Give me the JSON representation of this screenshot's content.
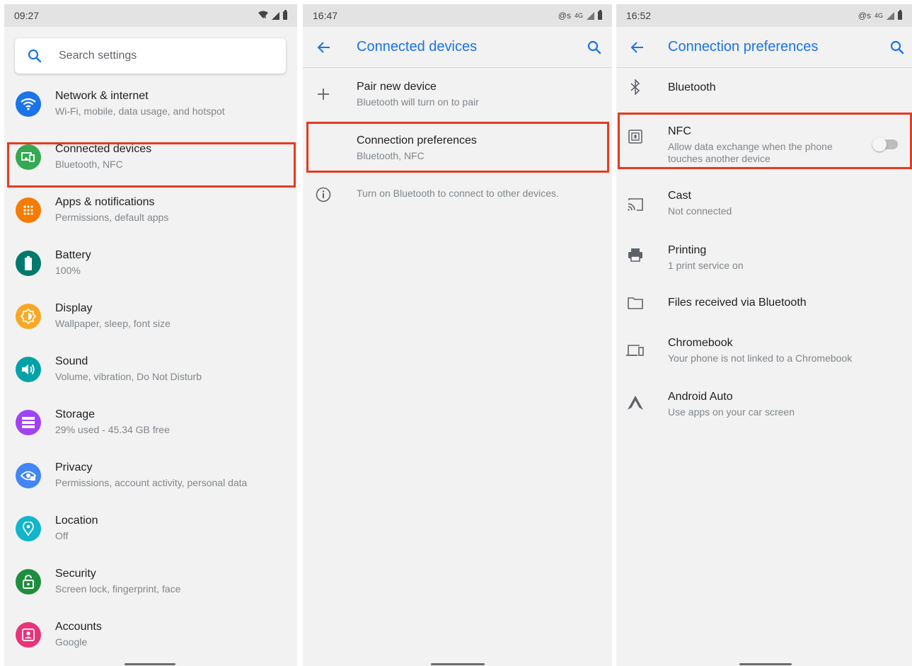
{
  "colors": {
    "accent": "#1a73e8",
    "highlight": "#e53b1f",
    "network": "#1a73e8",
    "connected": "#34a853",
    "apps": "#f57c00",
    "battery": "#00796b",
    "display": "#f9a825",
    "sound": "#00a2a8",
    "storage": "#a142f4",
    "privacy": "#4285f4",
    "location": "#12b5cb",
    "security": "#1e8e3e",
    "accounts": "#e8337a"
  },
  "screen1": {
    "status": {
      "time": "09:27",
      "icons": [
        "wifi-icon",
        "signal-icon",
        "battery-icon"
      ]
    },
    "search": {
      "placeholder": "Search settings",
      "icon": "search-icon"
    },
    "items": [
      {
        "title": "Network & internet",
        "subtitle": "Wi-Fi, mobile, data usage, and hotspot",
        "icon": "wifi-icon"
      },
      {
        "title": "Connected devices",
        "subtitle": "Bluetooth, NFC",
        "icon": "connected-devices-icon"
      },
      {
        "title": "Apps & notifications",
        "subtitle": "Permissions, default apps",
        "icon": "apps-grid-icon"
      },
      {
        "title": "Battery",
        "subtitle": "100%",
        "icon": "battery-icon"
      },
      {
        "title": "Display",
        "subtitle": "Wallpaper, sleep, font size",
        "icon": "brightness-icon"
      },
      {
        "title": "Sound",
        "subtitle": "Volume, vibration, Do Not Disturb",
        "icon": "volume-icon"
      },
      {
        "title": "Storage",
        "subtitle": "29% used - 45.34 GB free",
        "icon": "storage-icon"
      },
      {
        "title": "Privacy",
        "subtitle": "Permissions, account activity, personal data",
        "icon": "privacy-eye-icon"
      },
      {
        "title": "Location",
        "subtitle": "Off",
        "icon": "location-pin-icon"
      },
      {
        "title": "Security",
        "subtitle": "Screen lock, fingerprint, face",
        "icon": "lock-icon"
      },
      {
        "title": "Accounts",
        "subtitle": "Google",
        "icon": "account-icon"
      }
    ]
  },
  "screen2": {
    "status": {
      "time": "16:47",
      "icons": [
        "cast-status-icon",
        "4g-icon",
        "signal-icon",
        "battery-icon"
      ],
      "cast_label": "@s",
      "net_label": "4G"
    },
    "title": "Connected devices",
    "items": [
      {
        "title": "Pair new device",
        "subtitle": "Bluetooth will turn on to pair",
        "icon": "plus-icon"
      },
      {
        "title": "Connection preferences",
        "subtitle": "Bluetooth, NFC",
        "icon": ""
      }
    ],
    "info": "Turn on Bluetooth to connect to other devices."
  },
  "screen3": {
    "status": {
      "time": "16:52",
      "icons": [
        "cast-status-icon",
        "4g-icon",
        "signal-icon",
        "battery-icon"
      ],
      "cast_label": "@s",
      "net_label": "4G"
    },
    "title": "Connection preferences",
    "items": [
      {
        "title": "Bluetooth",
        "subtitle": "",
        "icon": "bluetooth-icon"
      },
      {
        "title": "NFC",
        "subtitle": "Allow data exchange when the phone",
        "subtitle2": "touches another device",
        "icon": "nfc-icon",
        "toggle": false
      },
      {
        "title": "Cast",
        "subtitle": "Not connected",
        "icon": "cast-icon"
      },
      {
        "title": "Printing",
        "subtitle": "1 print service on",
        "icon": "printer-icon"
      },
      {
        "title": "Files received via Bluetooth",
        "subtitle": "",
        "icon": "folder-icon"
      },
      {
        "title": "Chromebook",
        "subtitle": "Your phone is not linked to a Chromebook",
        "icon": "chromebook-icon"
      },
      {
        "title": "Android Auto",
        "subtitle": "Use apps on your car screen",
        "icon": "android-auto-icon"
      }
    ]
  }
}
